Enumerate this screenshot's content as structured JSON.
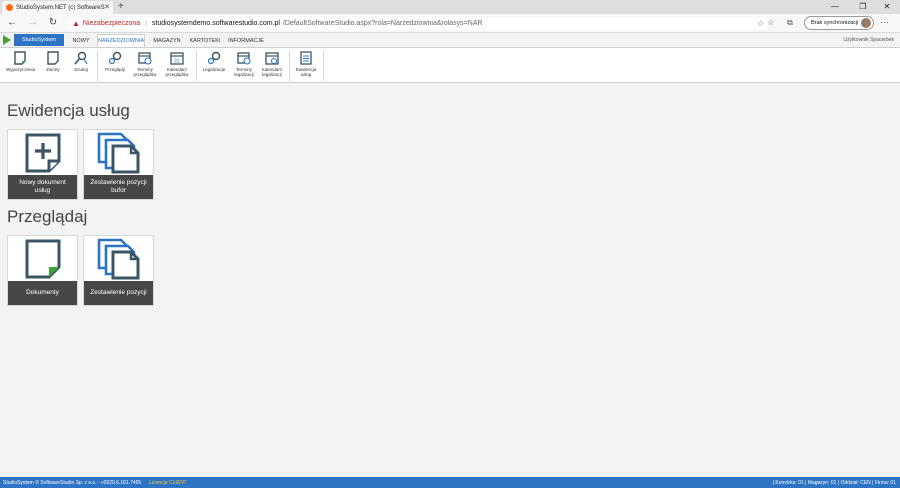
{
  "browser": {
    "tab_title": "StudioSystem.NET (c) SoftwareS",
    "new_tab": "+",
    "nav_back": "←",
    "nav_forward": "→",
    "nav_reload": "↻",
    "insecure_label": "Niezabezpieczona",
    "url_host": "studiosystemdemo.softwarestudio.com.pl",
    "url_path": "/DefaultSoftwareStudio.aspx?rola=Narzedziownia&rolasys=NAR",
    "sync_label": "Brak synchronizacji",
    "more": "···",
    "win_minimize": "—",
    "win_maximize": "❐",
    "win_close": "✕"
  },
  "appbar": {
    "brand": "StudioSystem",
    "tabs": [
      {
        "label": "NOWY"
      },
      {
        "label": "NARZEDZIOWNIA"
      },
      {
        "label": "MAGAZYN"
      },
      {
        "label": "KARTOTEKI"
      },
      {
        "label": "INFORMACJE"
      }
    ],
    "user": "Użytkownik Spacerbek"
  },
  "ribbon": {
    "wypozyczenia": "Wypożyczenia",
    "zwroty": "Zwroty",
    "szukaj": "Szukaj",
    "przeglady": "Przeglądy",
    "terminy_przegladow_1": "Terminy",
    "terminy_przegladow_2": "przeglądów",
    "kalendarz_przegladow_1": "Kalendarz",
    "kalendarz_przegladow_2": "przeglądów",
    "legalizacje": "Legalizacje",
    "terminy_legalizacji_1": "Terminy",
    "terminy_legalizacji_2": "legalizacji",
    "kalendarz_legalizacji_1": "Kalendarz",
    "kalendarz_legalizacji_2": "legalizacji",
    "ewidencja_uslug_1": "Ewidencja",
    "ewidencja_uslug_2": "usług"
  },
  "main": {
    "section1_title": "Ewidencja usług",
    "tile_nowy_line1": "Nowy dokument",
    "tile_nowy_line2": "usług",
    "tile_zest_bufor_line1": "Zestawienie pozycji",
    "tile_zest_bufor_line2": "bufor",
    "section2_title": "Przeglądaj",
    "tile_dokumenty": "Dokumenty",
    "tile_zestawienie": "Zestawienie pozycji"
  },
  "footer": {
    "copyright": "StudioSystem © SoftwareStudio Sp. z o.o. - v2020.6.161.7465",
    "license": "Licencja CLIENT",
    "status": "| Komórka: 01 | Magazyn: 01 | Oddział: CEN | Firma: 01"
  },
  "colors": {
    "accent": "#2e74c5",
    "tile_label_bg": "#474747",
    "icon_dark": "#3a5566",
    "icon_green": "#3fa535"
  }
}
